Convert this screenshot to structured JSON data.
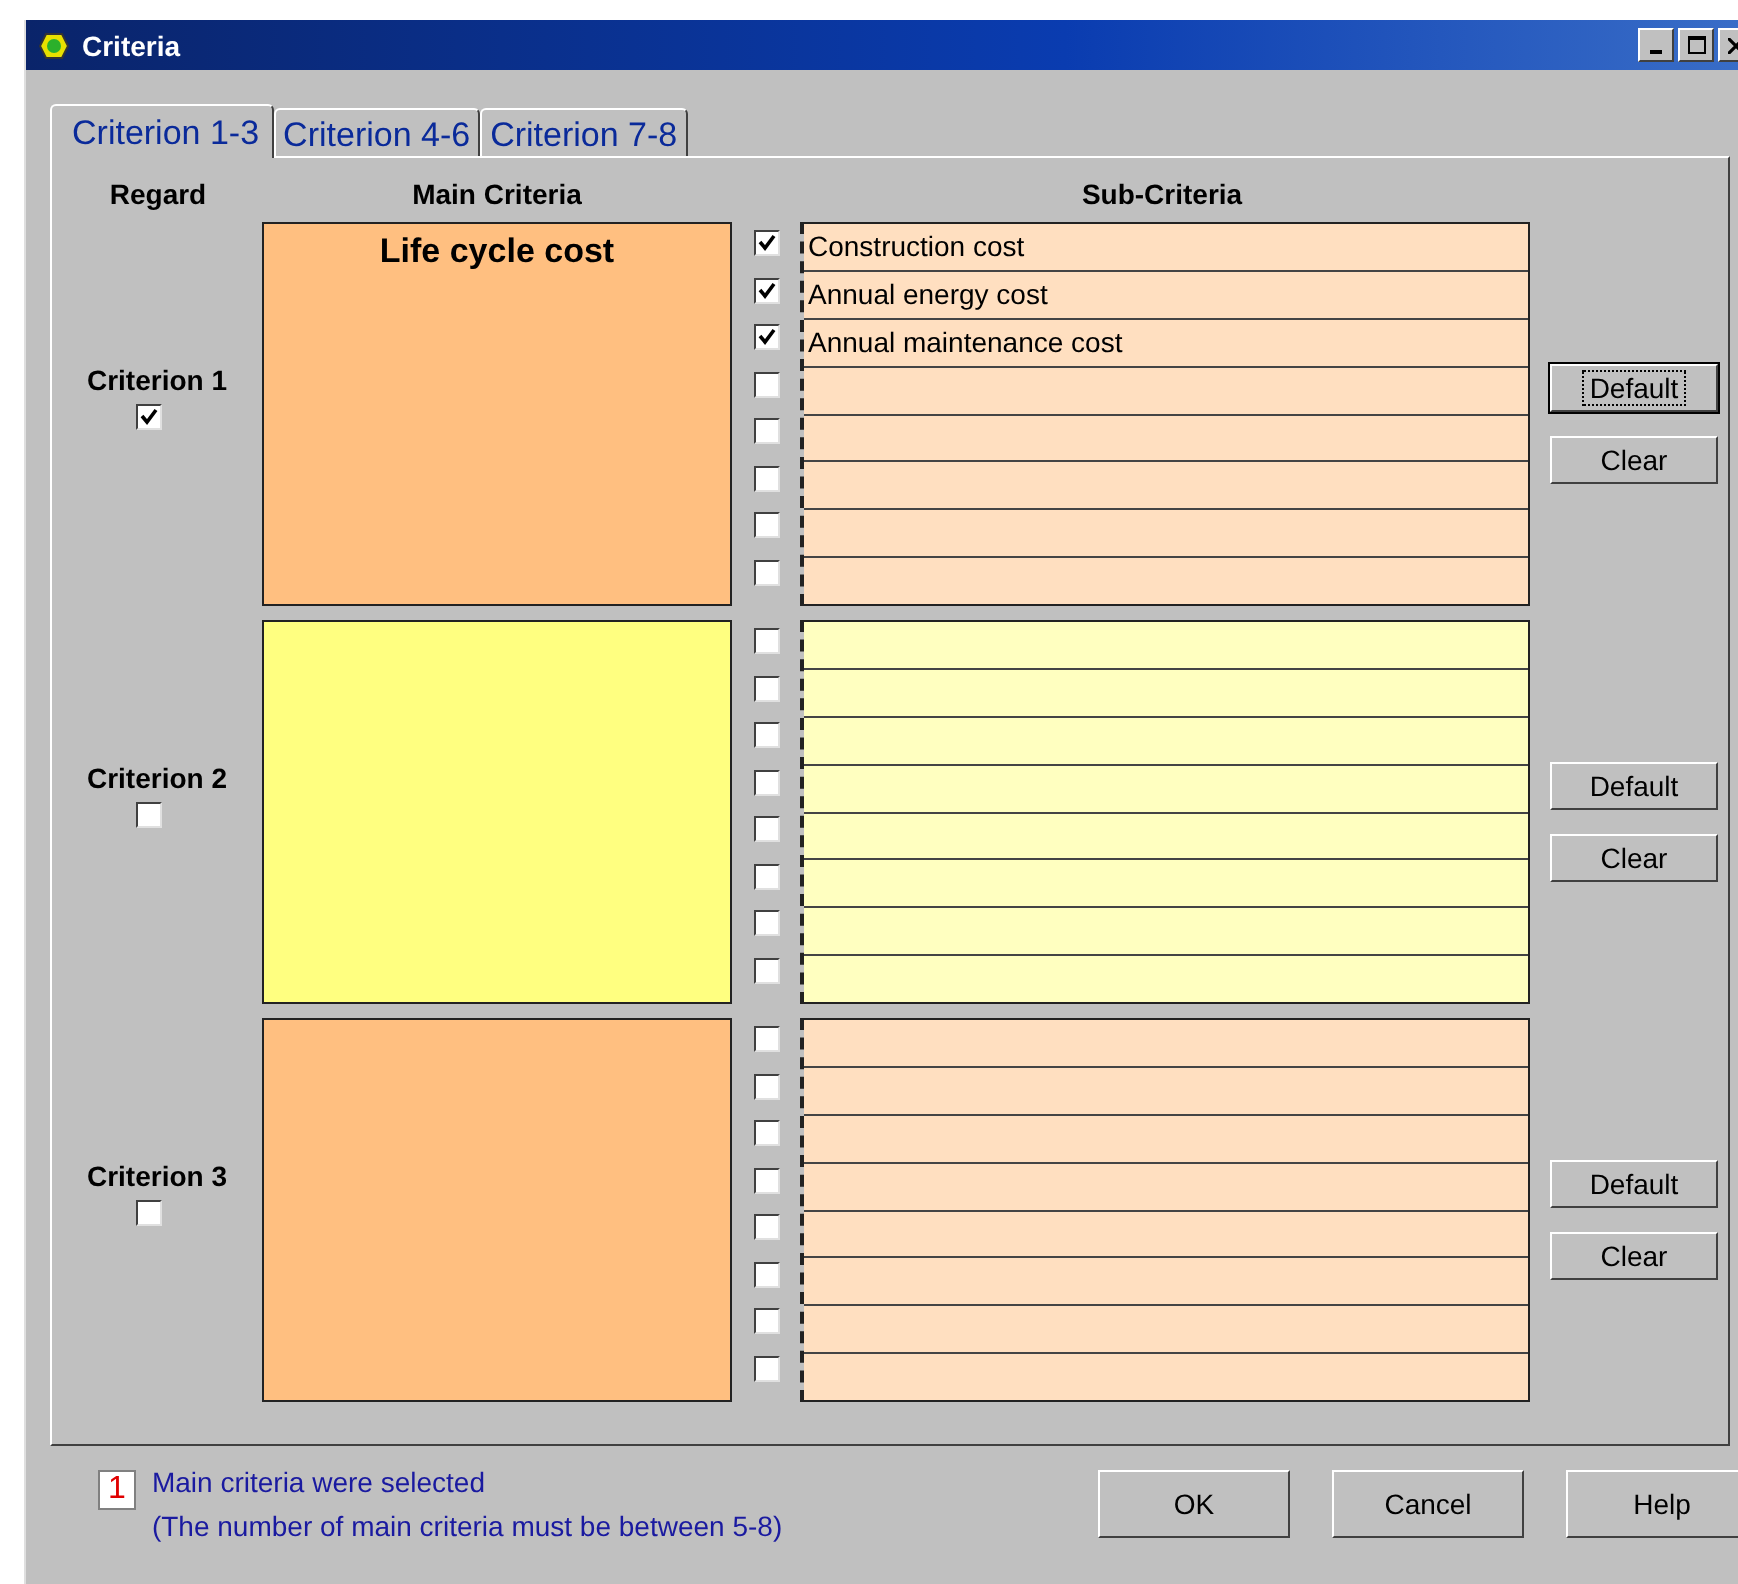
{
  "window": {
    "title": "Criteria"
  },
  "tabs": [
    {
      "label": "Criterion 1-3",
      "selected": true
    },
    {
      "label": "Criterion 4-6",
      "selected": false
    },
    {
      "label": "Criterion 7-8",
      "selected": false
    }
  ],
  "headers": {
    "regard": "Regard",
    "main": "Main Criteria",
    "sub": "Sub-Criteria"
  },
  "criteria": [
    {
      "label": "Criterion 1",
      "regarded": true,
      "color": "#ffbf80",
      "main": "Life cycle cost",
      "default_button": {
        "label": "Default",
        "focused": true
      },
      "clear_button": "Clear",
      "subcriteria": [
        {
          "text": "Construction cost",
          "checked": true
        },
        {
          "text": "Annual energy cost",
          "checked": true
        },
        {
          "text": "Annual maintenance cost",
          "checked": true
        },
        {
          "checked": false
        },
        {
          "checked": false
        },
        {
          "checked": false
        },
        {
          "checked": false
        },
        {
          "checked": false
        }
      ]
    },
    {
      "label": "Criterion 2",
      "regarded": false,
      "color": "#ffff80",
      "default_button": {
        "label": "Default",
        "focused": false
      },
      "clear_button": "Clear",
      "subcriteria": [
        {
          "checked": false
        },
        {
          "checked": false
        },
        {
          "checked": false
        },
        {
          "checked": false
        },
        {
          "checked": false
        },
        {
          "checked": false
        },
        {
          "checked": false
        },
        {
          "checked": false
        }
      ]
    },
    {
      "label": "Criterion 3",
      "regarded": false,
      "color": "#ffbf80",
      "default_button": {
        "label": "Default",
        "focused": false
      },
      "clear_button": "Clear",
      "subcriteria": [
        {
          "checked": false
        },
        {
          "checked": false
        },
        {
          "checked": false
        },
        {
          "checked": false
        },
        {
          "checked": false
        },
        {
          "checked": false
        },
        {
          "checked": false
        },
        {
          "checked": false
        }
      ]
    }
  ],
  "footer": {
    "count": "1",
    "message": "Main criteria were selected",
    "note": "(The number of main criteria must be between 5-8)"
  },
  "buttons": [
    "OK",
    "Cancel",
    "Help"
  ]
}
